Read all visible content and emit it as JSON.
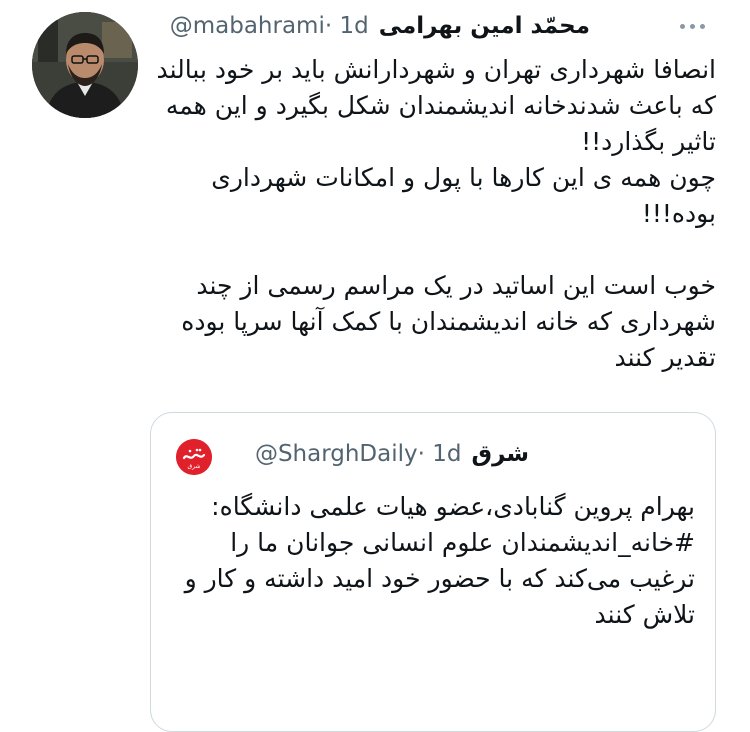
{
  "tweet": {
    "author_name": "محمّد امین بهرامی",
    "author_handle": "@mabahrami",
    "time": "· 1d",
    "text": "انصافا شهرداری تهران و شهردارانش باید بر خود ببالند که باعث شدندخانه اندیشمندان شکل بگیرد و این همه تاثیر بگذارد!!\nچون همه ی این کارها با پول و امکانات شهرداری بوده!!!\n\nخوب است این اساتید در یک مراسم رسمی از چند شهرداری که خانه اندیشمندان با کمک آنها سرپا بوده تقدیر کنند"
  },
  "quoted": {
    "author_name": "شرق",
    "author_handle": "@SharghDaily",
    "time": "· 1d",
    "logo_text": "شرق",
    "text": "بهرام پروین گنابادی،عضو هیات علمی دانشگاه:\n#خانه_اندیشمندان علوم انسانی جوانان ما را ترغیب می‌کند که با حضور خود امید داشته و کار و تلاش کنند"
  },
  "colors": {
    "text": "#0f1419",
    "secondary": "#536471",
    "border": "#cfd9de",
    "logo_red": "#e0202b"
  }
}
